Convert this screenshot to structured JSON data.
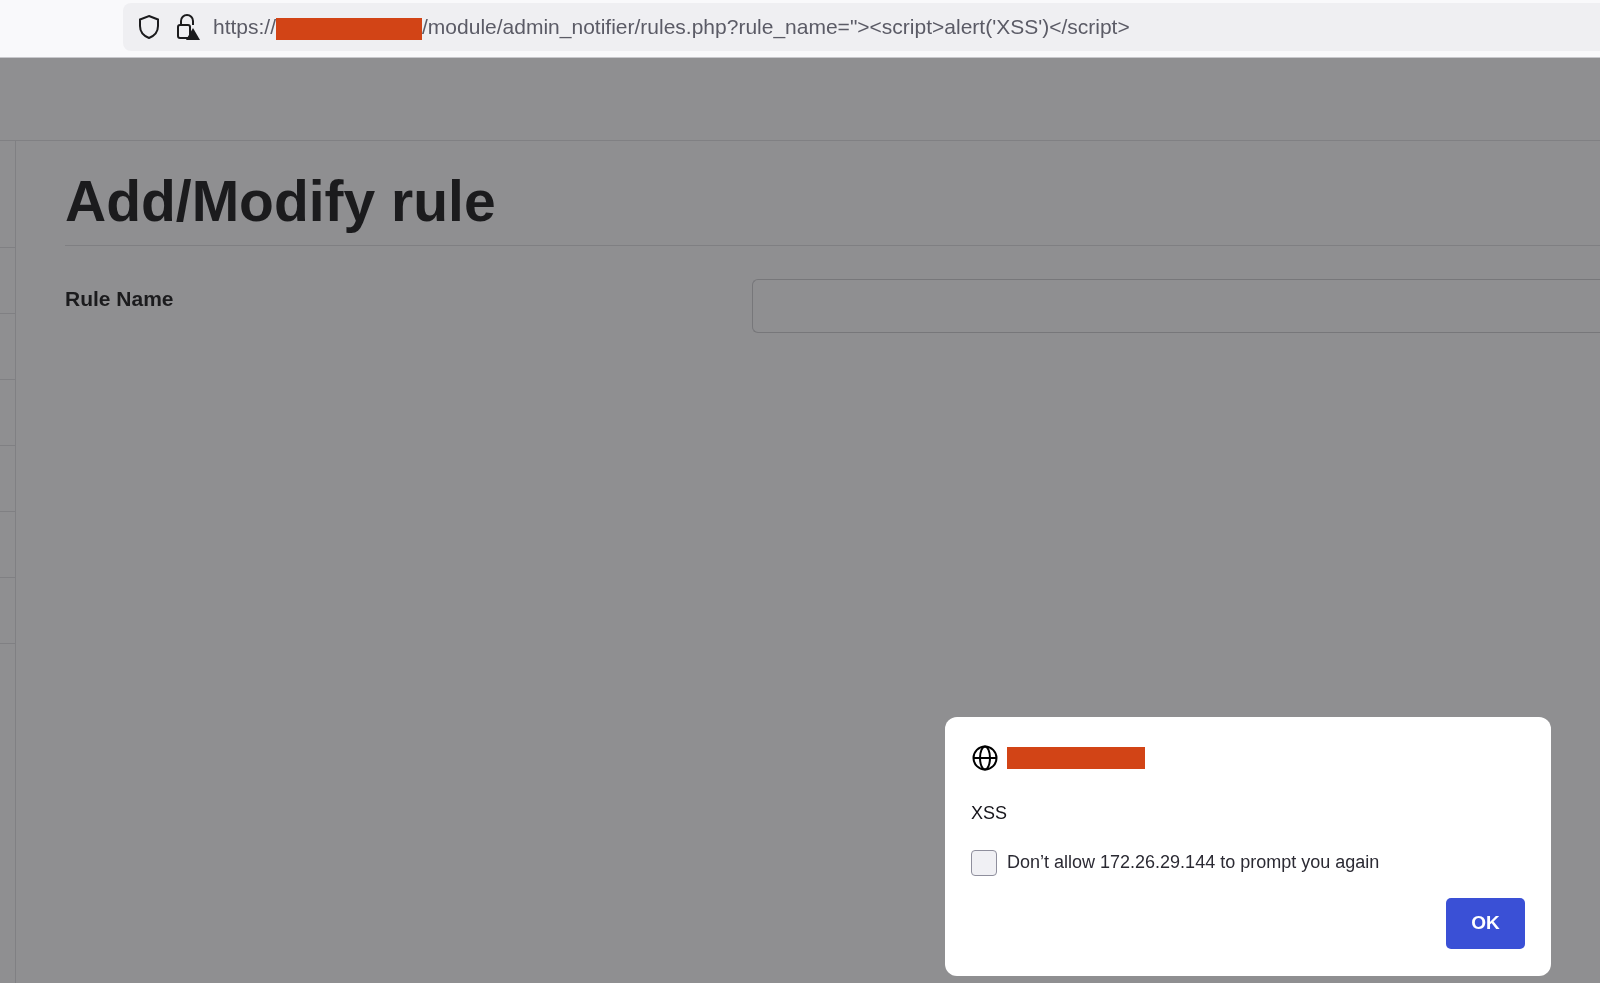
{
  "address_bar": {
    "url_prefix": "https://",
    "url_redacted": true,
    "url_path": "/module/admin_notifier/rules.php?rule_name=\"><script>alert('XSS')</script>"
  },
  "page": {
    "title": "Add/Modify rule",
    "fields": [
      {
        "label": "Rule Name"
      }
    ]
  },
  "alert_dialog": {
    "site_redacted": true,
    "message": "XSS",
    "checkbox": {
      "label": "Don’t allow 172.26.29.144 to prompt you again",
      "checked": false
    },
    "buttons": [
      "OK"
    ]
  }
}
